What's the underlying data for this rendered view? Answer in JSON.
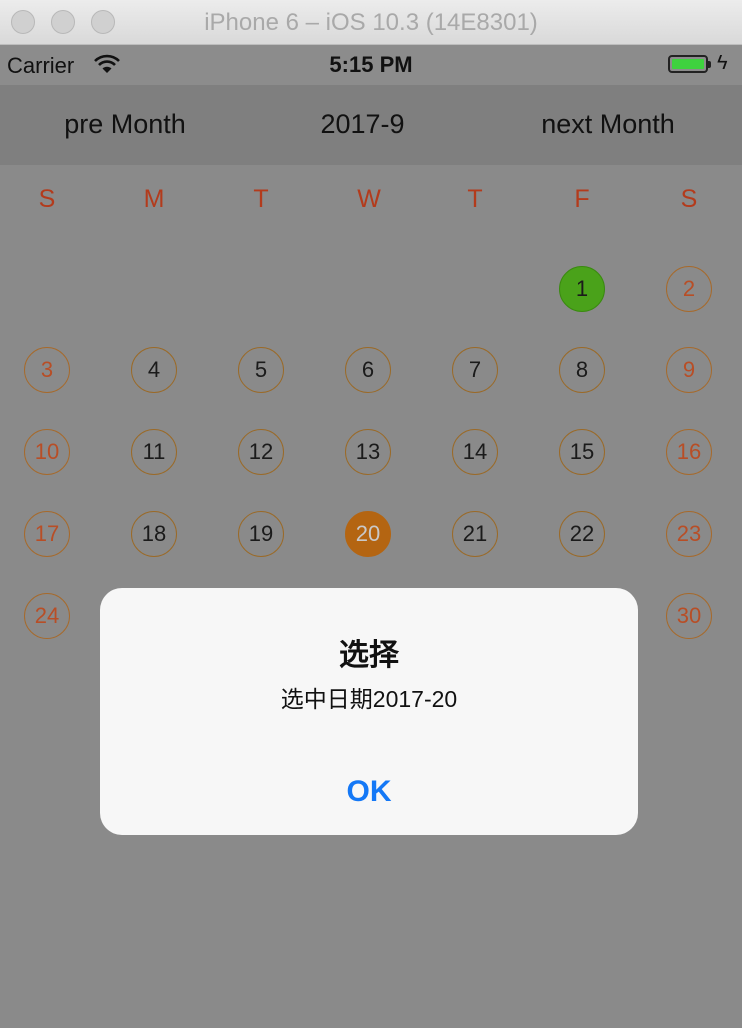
{
  "window": {
    "title": "iPhone 6 – iOS 10.3 (14E8301)"
  },
  "status_bar": {
    "carrier": "Carrier",
    "time": "5:15 PM",
    "battery_color": "#3ed23e"
  },
  "nav": {
    "prev_label": "pre Month",
    "current_label": "2017-9",
    "next_label": "next Month"
  },
  "weekdays": [
    "S",
    "M",
    "T",
    "W",
    "T",
    "F",
    "S"
  ],
  "calendar": {
    "days": [
      "1",
      "2",
      "3",
      "4",
      "5",
      "6",
      "7",
      "8",
      "9",
      "10",
      "11",
      "12",
      "13",
      "14",
      "15",
      "16",
      "17",
      "18",
      "19",
      "20",
      "21",
      "22",
      "23",
      "24",
      "30"
    ],
    "today": "1",
    "selected": "20"
  },
  "alert": {
    "title": "选择",
    "message": "选中日期2017-20",
    "ok_label": "OK"
  },
  "colors": {
    "weekend_text": "#b84e26",
    "weekday_header": "#b33b1c",
    "today_fill": "#4aa21a",
    "selected_fill": "#b46512",
    "alert_button": "#1478f6"
  }
}
